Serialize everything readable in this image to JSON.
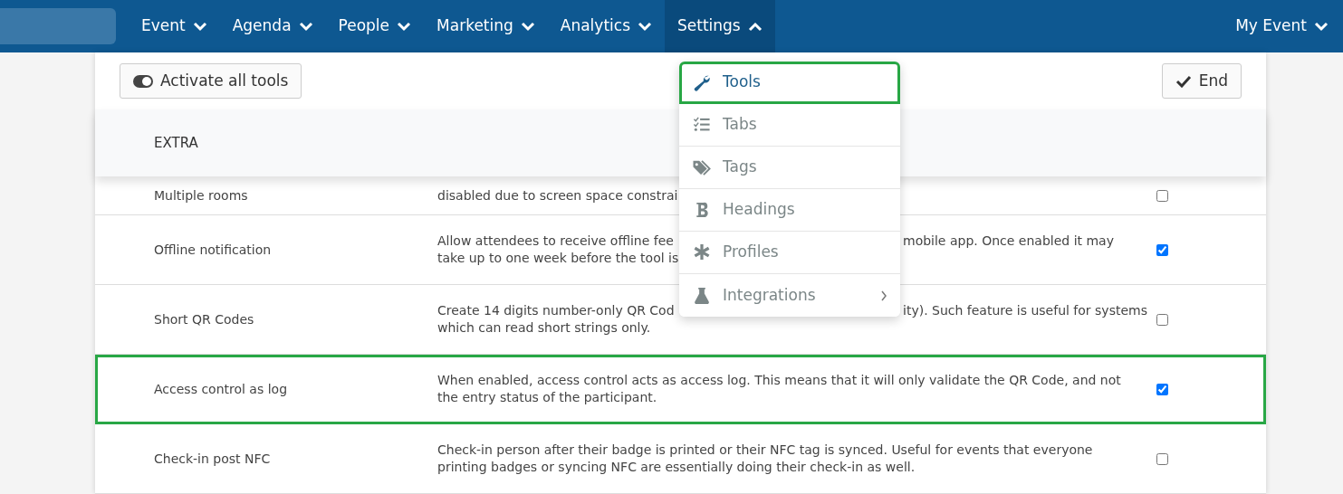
{
  "nav": {
    "items": [
      {
        "label": "Event",
        "expanded": false
      },
      {
        "label": "Agenda",
        "expanded": false
      },
      {
        "label": "People",
        "expanded": false
      },
      {
        "label": "Marketing",
        "expanded": false
      },
      {
        "label": "Analytics",
        "expanded": false
      },
      {
        "label": "Settings",
        "expanded": true
      }
    ],
    "right_item": {
      "label": "My Event",
      "expanded": false
    }
  },
  "toolbar": {
    "activate_button": "Activate all tools",
    "end_button": "End"
  },
  "section_header": "EXTRA",
  "rows": [
    {
      "name": "Multiple rooms",
      "checked": false,
      "highlighted": false,
      "kind": "covered",
      "lines": [
        {
          "left": "disabled due to screen space constrai"
        }
      ]
    },
    {
      "name": "Offline notification",
      "checked": true,
      "highlighted": false,
      "kind": "covered",
      "lines": [
        {
          "left": "Allow attendees to receive offline fee",
          "right": "mobile app. Once enabled it may"
        },
        {
          "left": "take up to one week before the tool is"
        }
      ]
    },
    {
      "name": "Short QR Codes",
      "checked": false,
      "highlighted": false,
      "kind": "covered",
      "lines": [
        {
          "left": "Create 14 digits number-only QR Cod",
          "right": "ity). Such feature is useful for systems"
        },
        {
          "left": "which can read short strings only."
        }
      ]
    },
    {
      "name": "Access control as log",
      "checked": true,
      "highlighted": true,
      "kind": "plain",
      "description": "When enabled, access control acts as access log. This means that it will only validate the QR Code, and not the entry status of the participant."
    },
    {
      "name": "Check-in post NFC",
      "checked": false,
      "highlighted": false,
      "kind": "plain",
      "description": "Check-in person after their badge is printed or their NFC tag is synced. Useful for events that everyone printing badges or syncing NFC are essentially doing their check-in as well."
    }
  ],
  "dropdown": {
    "items": [
      {
        "label": "Tools",
        "selected": true,
        "highlighted": true,
        "has_submenu": false
      },
      {
        "label": "Tabs",
        "selected": false,
        "highlighted": false,
        "has_submenu": false
      },
      {
        "label": "Tags",
        "selected": false,
        "highlighted": false,
        "has_submenu": false
      },
      {
        "label": "Headings",
        "selected": false,
        "highlighted": false,
        "has_submenu": false
      },
      {
        "label": "Profiles",
        "selected": false,
        "highlighted": false,
        "has_submenu": false
      },
      {
        "label": "Integrations",
        "selected": false,
        "highlighted": false,
        "has_submenu": true
      }
    ]
  }
}
